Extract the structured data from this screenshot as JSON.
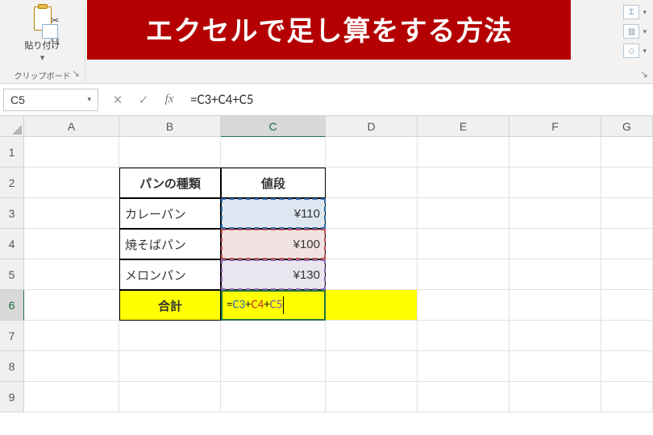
{
  "ribbon": {
    "paste_label": "貼り付け",
    "clipboard_group_label": "クリップボード"
  },
  "banner": {
    "text": "エクセルで足し算をする方法"
  },
  "formula_bar": {
    "name_box": "C5",
    "cancel_glyph": "✕",
    "enter_glyph": "✓",
    "fx_label": "fx",
    "formula": "=C3+C4+C5"
  },
  "columns": [
    "A",
    "B",
    "C",
    "D",
    "E",
    "F",
    "G"
  ],
  "rows": [
    "1",
    "2",
    "3",
    "4",
    "5",
    "6",
    "7",
    "8",
    "9"
  ],
  "table": {
    "header_b": "パンの種類",
    "header_c": "値段",
    "r3_b": "カレーパン",
    "r3_c": "¥110",
    "r4_b": "焼そばパン",
    "r4_c": "¥100",
    "r5_b": "メロンパン",
    "r5_c": "¥130",
    "r6_b": "合計",
    "r6_c_parts": {
      "eq": "=",
      "r1": "C3",
      "op": "+",
      "r2": "C4",
      "r3": "C5"
    }
  }
}
